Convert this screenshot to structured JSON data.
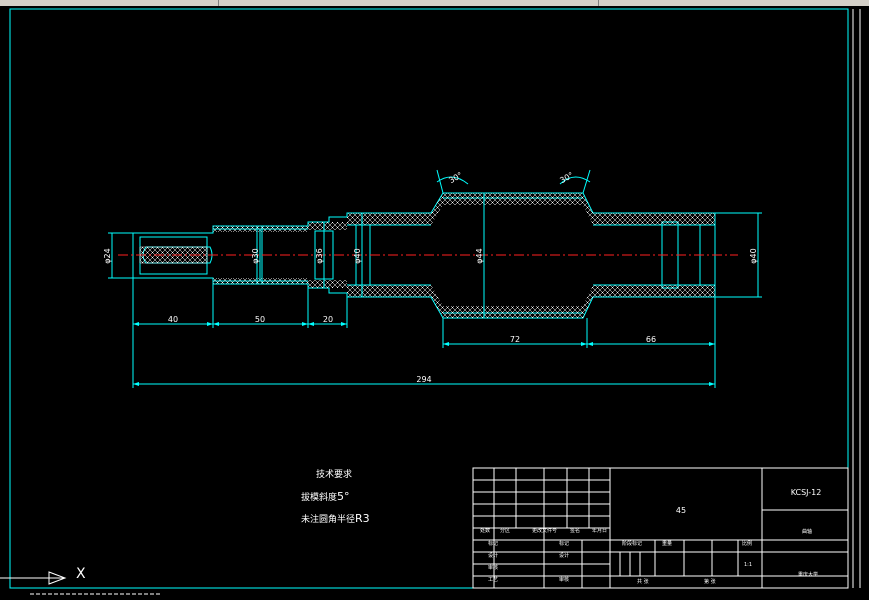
{
  "dimensions": {
    "d24": "φ24",
    "d30": "φ30",
    "d36": "φ36",
    "d40a": "φ40",
    "d44": "φ44",
    "d40b": "φ40",
    "len40": "40",
    "len50": "50",
    "len20": "20",
    "len72": "72",
    "len66": "66",
    "len294": "294",
    "ang1": "30°",
    "ang2": "30°"
  },
  "notes": {
    "title": "技术要求",
    "line1_prefix": "拔模斜度",
    "line1_value": "5°",
    "line2_prefix": "未注圆角半径",
    "line2_value": "R3"
  },
  "title_block": {
    "material": "45",
    "drawing_no": "KCSJ-12",
    "scale": "1:1",
    "name_cell": "曲轴",
    "company": "重庆大学",
    "row_labels": [
      "标记",
      "设计",
      "审核",
      "工艺"
    ],
    "col_labels": [
      "处数",
      "分区",
      "更改文件号",
      "签名",
      "年月日"
    ],
    "stage_labels": [
      "阶段标记",
      "重量",
      "比例"
    ],
    "sheet_labels": [
      "共 张",
      "第 张"
    ]
  },
  "ucs": {
    "x_label": "X"
  }
}
